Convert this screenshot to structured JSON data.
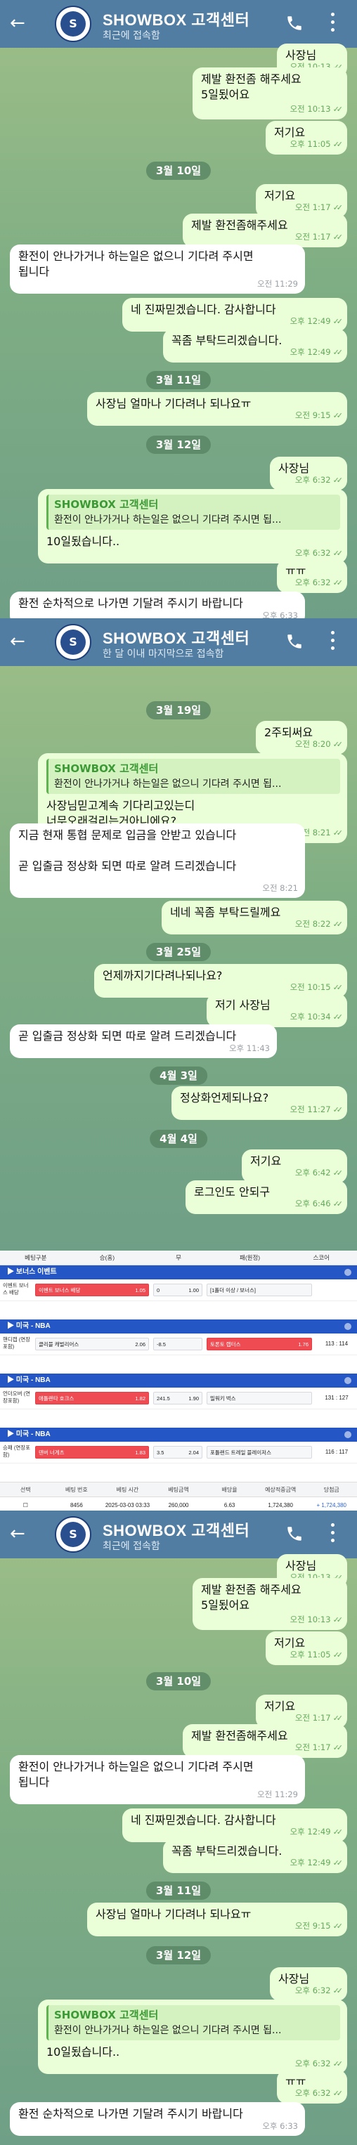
{
  "chat": {
    "title": "SHOWBOX 고객센터",
    "status_recent": "최근에 접속함",
    "status_month": "한 달 이내 마지막으로 접속함"
  },
  "messages_a": [
    {
      "type": "out",
      "text": "사장님",
      "time": "오전 10:13"
    },
    {
      "type": "out",
      "text": "제발 환전좀 해주세요\n5일됬어요",
      "time": "오전 10:13"
    },
    {
      "type": "out",
      "text": "저기요",
      "time": "오후 11:05"
    },
    {
      "type": "date",
      "text": "3월 10일"
    },
    {
      "type": "out",
      "text": "저기요",
      "time": "오전 1:17"
    },
    {
      "type": "out",
      "text": "제발 환전좀해주세요",
      "time": "오전 1:17"
    },
    {
      "type": "in",
      "text": "환전이 안나가거나 하는일은 없으니 기다려 주시면\n됩니다",
      "time": "오전 11:29"
    },
    {
      "type": "out",
      "text": "네 진짜믿겠습니다. 감사합니다",
      "time": "오후 12:49"
    },
    {
      "type": "out",
      "text": "꼭좀 부탁드리겠습니다.",
      "time": "오후 12:49"
    },
    {
      "type": "date",
      "text": "3월 11일"
    },
    {
      "type": "out",
      "text": "사장님 얼마나 기다려나 되나요ㅠ",
      "time": "오전 9:15"
    },
    {
      "type": "date",
      "text": "3월 12일"
    },
    {
      "type": "out",
      "text": "사장님",
      "time": "오후 6:32"
    },
    {
      "type": "out",
      "quote_name": "SHOWBOX 고객센터",
      "quote_text": "환전이 안나가거나 하는일은 없으니 기다려 주시면 됩...",
      "text": "10일됬습니다..",
      "time": "오후 6:32"
    },
    {
      "type": "out",
      "text": "ㅠㅠ",
      "time": "오후 6:32"
    },
    {
      "type": "in",
      "text": "환전 순차적으로 나가면 기달려 주시기 바랍니다",
      "time": "오후 6:33"
    }
  ],
  "messages_b": [
    {
      "type": "date",
      "text": "3월 19일"
    },
    {
      "type": "out",
      "text": "2주되써요",
      "time": "오전 8:20"
    },
    {
      "type": "out",
      "quote_name": "SHOWBOX 고객센터",
      "quote_text": "환전이 안나가거나 하는일은 없으니 기다려 주시면 됩...",
      "text": "사장님믿고계속 기다리고있는디\n너무오래걸리는거아니에요?",
      "time": "오전 8:21"
    },
    {
      "type": "in",
      "text": "지금 현재 통협 문제로 입금을 안받고 있습니다\n\n곧 입출금 정상화 되면 따로 알려 드리겠습니다",
      "time": "오전 8:21"
    },
    {
      "type": "out",
      "text": "네네 꼭좀 부탁드릴께요",
      "time": "오전 8:22"
    },
    {
      "type": "date",
      "text": "3월 25일"
    },
    {
      "type": "out",
      "text": "언제까지기다려나되나요?",
      "time": "오전 10:15"
    },
    {
      "type": "out",
      "text": "저기 사장님",
      "time": "오후 10:34"
    },
    {
      "type": "in",
      "text": "곧 입출금 정상화 되면 따로 알려 드리겠습니다",
      "time": "오후 11:43"
    },
    {
      "type": "date",
      "text": "4월 3일"
    },
    {
      "type": "out",
      "text": "정상화언제되나요?",
      "time": "오전 11:27"
    },
    {
      "type": "date",
      "text": "4월 4일"
    },
    {
      "type": "out",
      "text": "저기요",
      "time": "오후 6:42"
    },
    {
      "type": "out",
      "text": "로그인도 안되구",
      "time": "오후 6:46"
    }
  ],
  "bet": {
    "columns": [
      "베팅구분",
      "승(홈)",
      "무",
      "패(원정)",
      "스코어"
    ],
    "sections": [
      {
        "league": "보너스 이벤트",
        "rows": [
          {
            "label": "이벤트 보너스 배당",
            "home": "이벤트 보너스 배당",
            "home_odds": "1.05",
            "draw": "0",
            "draw_odds": "1.00",
            "away": "[1폴더 이상 / 보너스]",
            "away_odds": "",
            "score": ""
          }
        ]
      },
      {
        "league": "미국 - NBA",
        "rows": [
          {
            "label": "핸디캡 (연장포함)",
            "home": "클리블 캐벌리어스",
            "home_odds": "2.06",
            "draw": "-8.5",
            "draw_odds": "",
            "away": "토론토 랩터스",
            "away_odds": "1.76",
            "score": "113 : 114"
          }
        ]
      },
      {
        "league": "미국 - NBA",
        "rows": [
          {
            "label": "언더오버 (연장포함)",
            "home": "애틀랜타 호크스",
            "home_odds": "1.82",
            "draw": "241.5",
            "draw_odds": "1.90",
            "away": "밀워키 벅스",
            "away_odds": "",
            "score": "131 : 127"
          }
        ]
      },
      {
        "league": "미국 - NBA",
        "rows": [
          {
            "label": "승패 (연장포함)",
            "home": "덴버 너게츠",
            "home_odds": "1.83",
            "draw": "3.5",
            "draw_odds": "2.04",
            "away": "포틀랜드 트레일 블레이저스",
            "away_odds": "",
            "score": "116 : 117"
          }
        ]
      }
    ],
    "summary_head": [
      "선택",
      "베팅 번호",
      "베팅 시간",
      "베팅금액",
      "배당율",
      "예상적중금액",
      "당첨금"
    ],
    "summary_row": [
      "",
      "8456",
      "2025-03-03 03:33",
      "260,000",
      "6.63",
      "1,724,380",
      "+ 1,724,380"
    ]
  },
  "colors": {
    "header": "#517da2",
    "outgoing": "#eaffd7",
    "incoming": "#ffffff",
    "league": "#2456c5",
    "selected_odds": "#ee4b53"
  }
}
